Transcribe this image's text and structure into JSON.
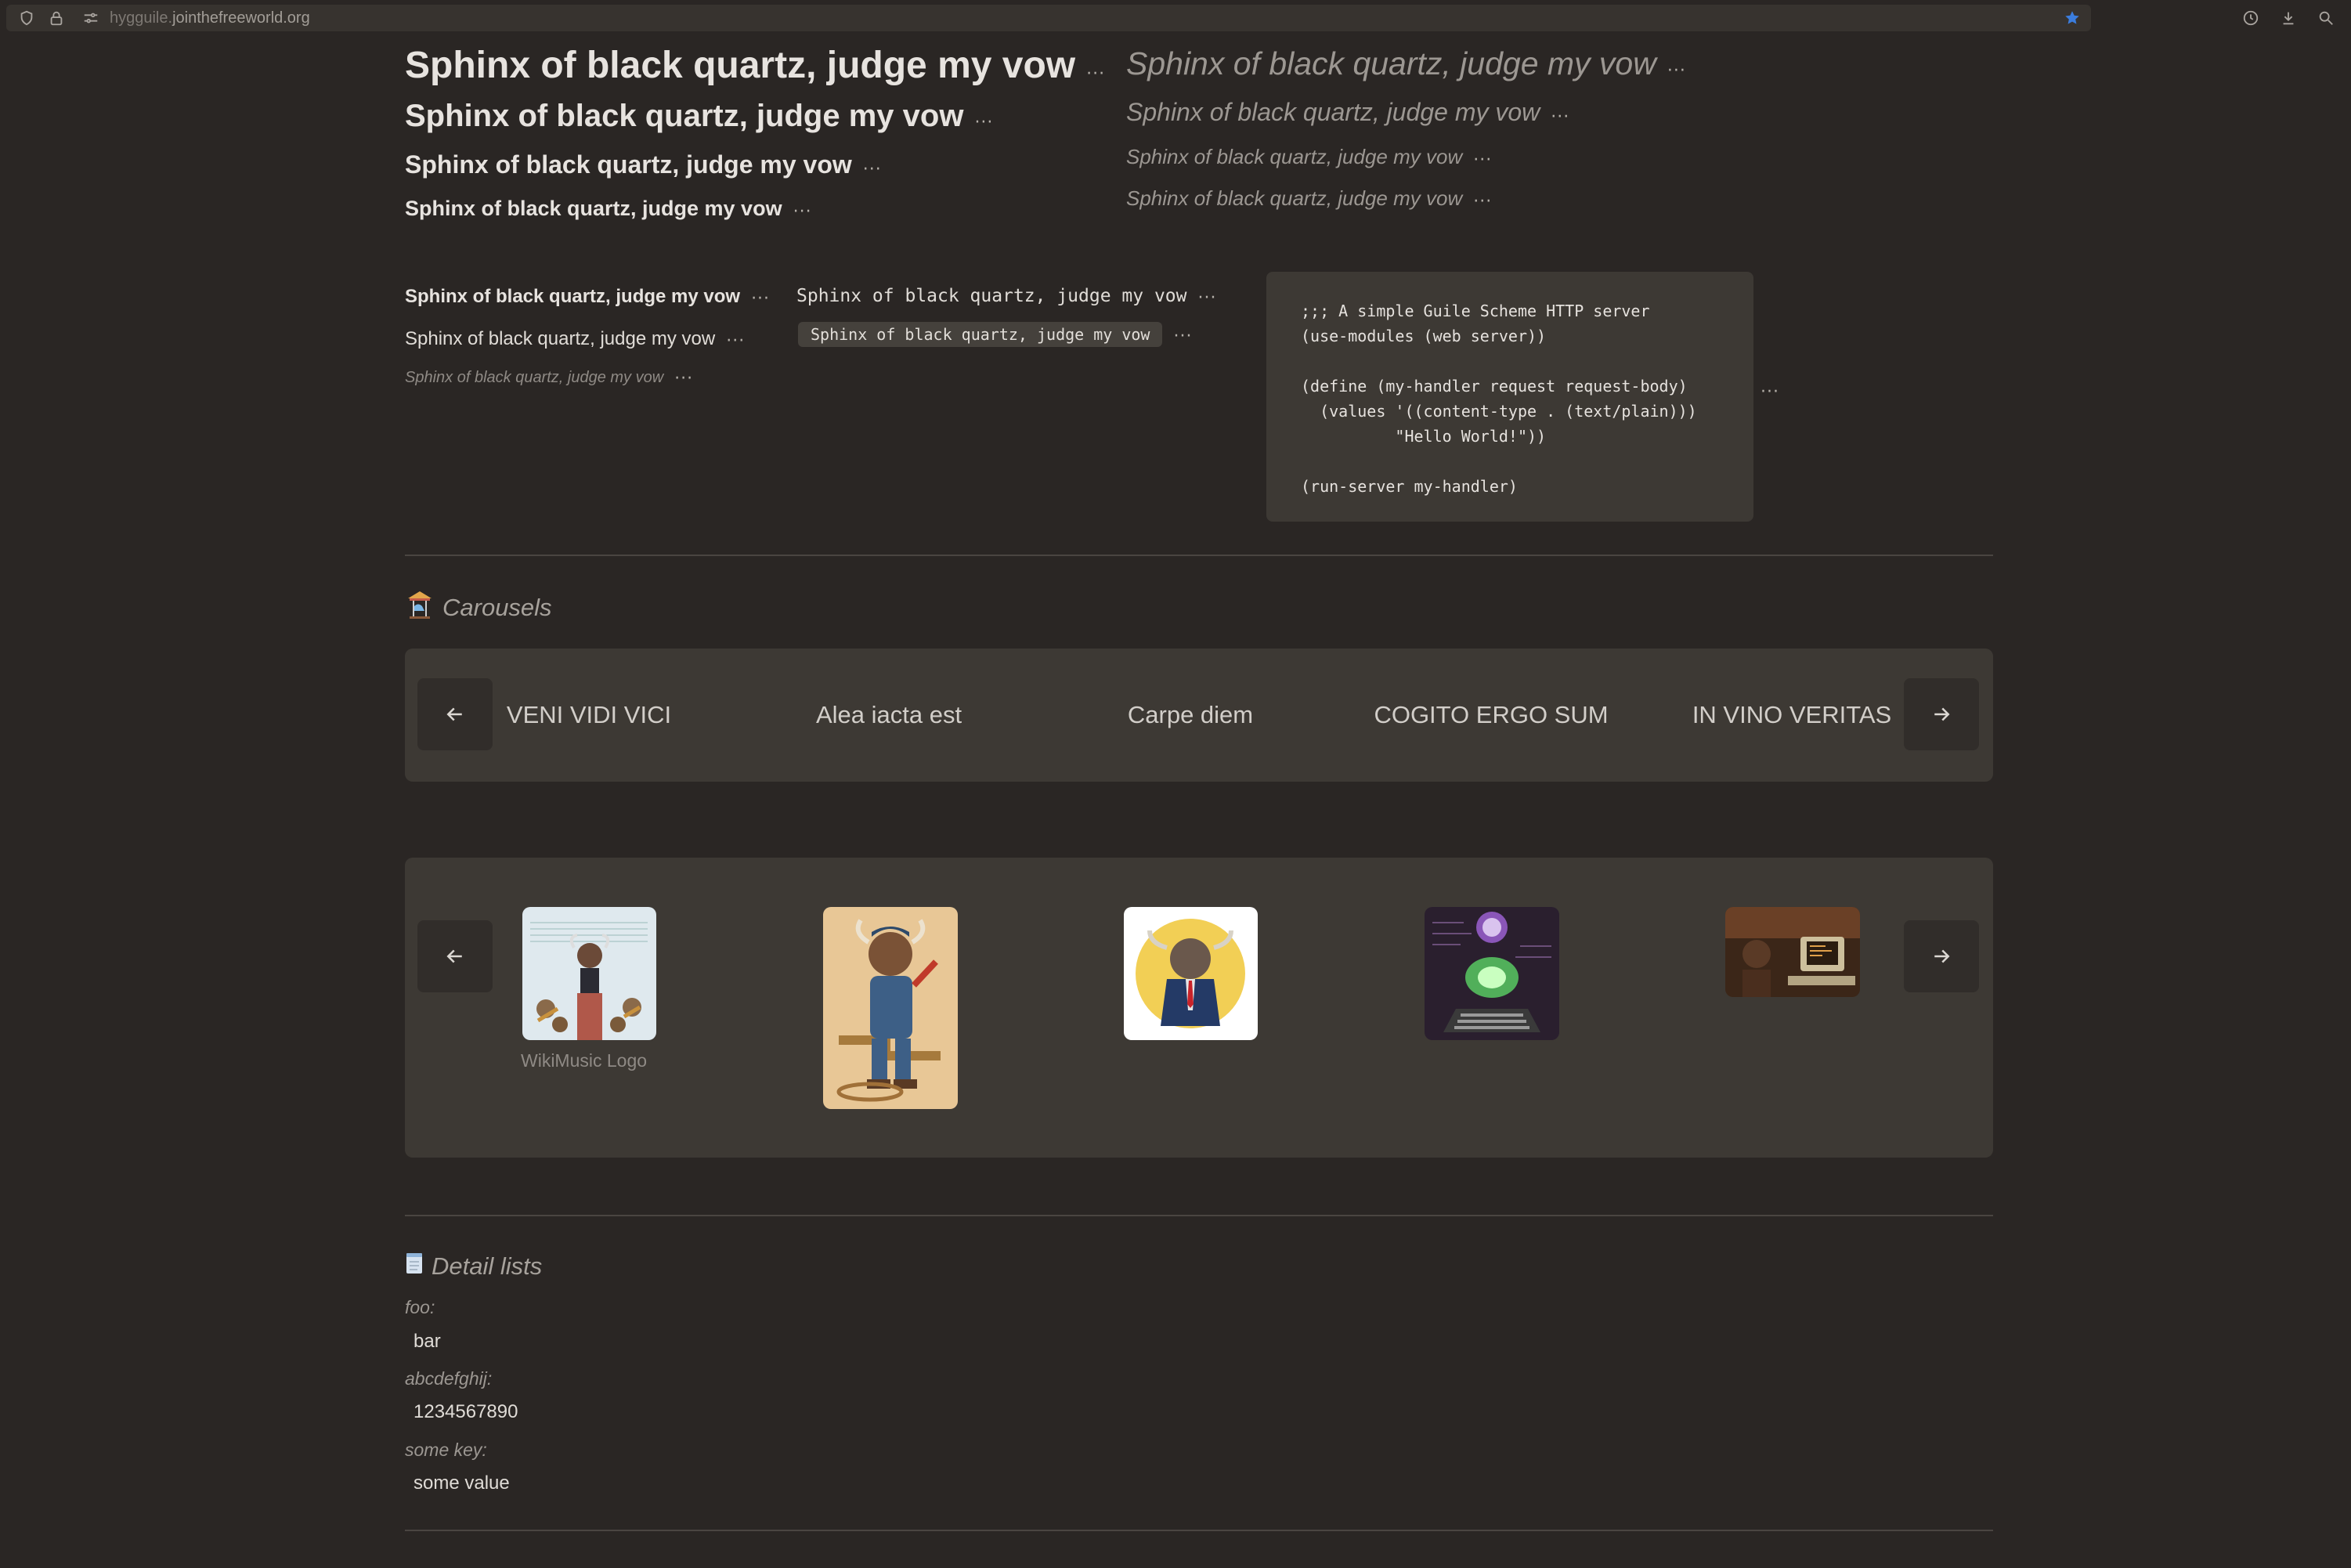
{
  "browser": {
    "url_subdomain": "hygguile.",
    "url_host": "jointhefreeworld.org"
  },
  "pangram": "Sphinx of black quartz, judge my vow",
  "ellipsis": "···",
  "code": {
    "block": ";;; A simple Guile Scheme HTTP server\n(use-modules (web server))\n\n(define (my-handler request request-body)\n  (values '((content-type . (text/plain)))\n          \"Hello World!\"))\n\n(run-server my-handler)",
    "inline": "Sphinx of black quartz, judge my vow"
  },
  "carousels": {
    "title": "Carousels",
    "text_items": [
      "VENI VIDI VICI",
      "Alea iacta est",
      "Carpe diem",
      "COGITO ERGO SUM",
      "IN VINO VERITAS"
    ],
    "image_caption": "WikiMusic Logo"
  },
  "detail_lists": {
    "title": "Detail lists",
    "items": [
      {
        "key": "foo:",
        "value": "bar"
      },
      {
        "key": "abcdefghij:",
        "value": "1234567890"
      },
      {
        "key": "some key:",
        "value": "some value"
      }
    ]
  },
  "colors": {
    "background": "#2a2624",
    "panel": "#3d3934",
    "accent_star": "#3b7ddd"
  }
}
